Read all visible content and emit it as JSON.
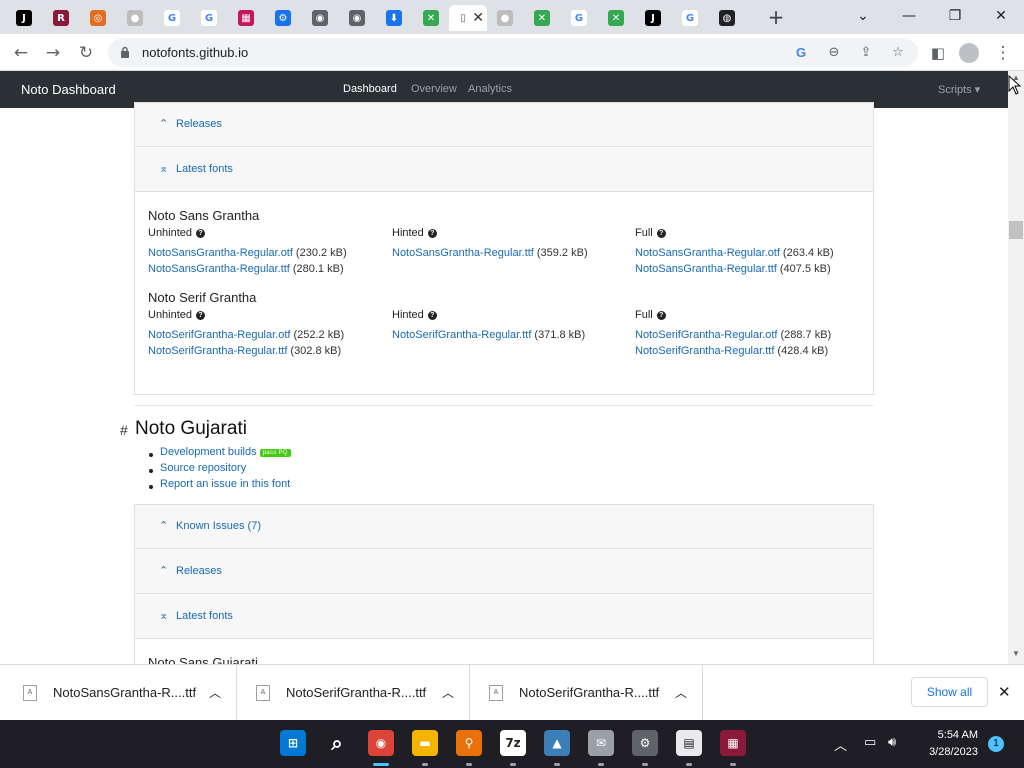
{
  "browser": {
    "tabs": [
      {
        "icon": "jetbrains-icon",
        "color": "#000000",
        "glyph": "J"
      },
      {
        "icon": "winrar-icon",
        "color": "#8b1a3a",
        "glyph": "R"
      },
      {
        "icon": "app-orange-icon",
        "color": "#e07020",
        "glyph": "◎"
      },
      {
        "icon": "github-icon",
        "color": "#bdbdbd",
        "glyph": "●"
      },
      {
        "icon": "google-icon",
        "color": "#ffffff",
        "glyph": "G"
      },
      {
        "icon": "google-bold-icon",
        "color": "#ffffff",
        "glyph": "G"
      },
      {
        "icon": "fontstruct-icon",
        "color": "#c2185b",
        "glyph": "▦"
      },
      {
        "icon": "settings-gear-icon",
        "color": "#1a73e8",
        "glyph": "⚙"
      },
      {
        "icon": "chrome-icon",
        "color": "#5f6368",
        "glyph": "◉"
      },
      {
        "icon": "chrome-icon-2",
        "color": "#5f6368",
        "glyph": "◉"
      },
      {
        "icon": "download-icon",
        "color": "#1a73e8",
        "glyph": "⬇"
      },
      {
        "icon": "noto-icon",
        "color": "#34a853",
        "glyph": "✕"
      },
      {
        "icon": "noto-dashboard-icon",
        "color": "#ffffff",
        "glyph": "▯",
        "active": true
      },
      {
        "icon": "github-icon-2",
        "color": "#bdbdbd",
        "glyph": "●"
      },
      {
        "icon": "noto-icon-2",
        "color": "#34a853",
        "glyph": "✕"
      },
      {
        "icon": "google-icon-2",
        "color": "#ffffff",
        "glyph": "G"
      },
      {
        "icon": "noto-icon-3",
        "color": "#34a853",
        "glyph": "✕"
      },
      {
        "icon": "jetbrains-icon-2",
        "color": "#000000",
        "glyph": "J"
      },
      {
        "icon": "google-icon-3",
        "color": "#ffffff",
        "glyph": "G"
      },
      {
        "icon": "globe-icon",
        "color": "#202124",
        "glyph": "◍"
      }
    ],
    "url": "notofonts.github.io"
  },
  "navbar": {
    "brand": "Noto Dashboard",
    "links": [
      "Dashboard",
      "Overview",
      "Analytics"
    ],
    "scripts": "Scripts ▾"
  },
  "grantha": {
    "releases_label": "Releases",
    "latest_label": "Latest fonts",
    "families": [
      {
        "name": "Noto Sans Grantha",
        "unhinted": [
          {
            "file": "NotoSansGrantha-Regular.otf",
            "size": "(230.2 kB)"
          },
          {
            "file": "NotoSansGrantha-Regular.ttf",
            "size": "(280.1 kB)"
          }
        ],
        "hinted": [
          {
            "file": "NotoSansGrantha-Regular.ttf",
            "size": "(359.2 kB)"
          }
        ],
        "full": [
          {
            "file": "NotoSansGrantha-Regular.otf",
            "size": "(263.4 kB)"
          },
          {
            "file": "NotoSansGrantha-Regular.ttf",
            "size": "(407.5 kB)"
          }
        ]
      },
      {
        "name": "Noto Serif Grantha",
        "unhinted": [
          {
            "file": "NotoSerifGrantha-Regular.otf",
            "size": "(252.2 kB)"
          },
          {
            "file": "NotoSerifGrantha-Regular.ttf",
            "size": "(302.8 kB)"
          }
        ],
        "hinted": [
          {
            "file": "NotoSerifGrantha-Regular.ttf",
            "size": "(371.8 kB)"
          }
        ],
        "full": [
          {
            "file": "NotoSerifGrantha-Regular.otf",
            "size": "(288.7 kB)"
          },
          {
            "file": "NotoSerifGrantha-Regular.ttf",
            "size": "(428.4 kB)"
          }
        ]
      }
    ],
    "col_labels": {
      "unhinted": "Unhinted",
      "hinted": "Hinted",
      "full": "Full"
    }
  },
  "gujarati": {
    "hash": "#",
    "title": "Noto Gujarati",
    "links": [
      "Development builds",
      "Source repository",
      "Report an issue in this font"
    ],
    "badge": "pass PQ",
    "known_issues": "Known Issues (7)",
    "releases_label": "Releases",
    "latest_label": "Latest fonts",
    "first_family": "Noto Sans Gujarati"
  },
  "downloads": {
    "items": [
      "NotoSansGrantha-R....ttf",
      "NotoSerifGrantha-R....ttf",
      "NotoSerifGrantha-R....ttf"
    ],
    "show_all": "Show all"
  },
  "taskbar": {
    "apps": [
      {
        "name": "start-icon",
        "color": "#0078d4",
        "glyph": "⊞"
      },
      {
        "name": "search-icon",
        "color": "transparent",
        "glyph": "⌕"
      },
      {
        "name": "chrome-taskbar-icon",
        "color": "#db4437",
        "glyph": "◉",
        "active": true
      },
      {
        "name": "file-explorer-icon",
        "color": "#f4b400",
        "glyph": "▬"
      },
      {
        "name": "magnifier-app-icon",
        "color": "#e8710a",
        "glyph": "⚲"
      },
      {
        "name": "7zip-icon",
        "color": "#ffffff",
        "glyph": "7z"
      },
      {
        "name": "inkscape-icon",
        "color": "#3c7fb8",
        "glyph": "▲"
      },
      {
        "name": "mail-app-icon",
        "color": "#9aa0a6",
        "glyph": "✉"
      },
      {
        "name": "settings-taskbar-icon",
        "color": "#5f6368",
        "glyph": "⚙"
      },
      {
        "name": "notepad-icon",
        "color": "#e8eaed",
        "glyph": "▤"
      },
      {
        "name": "winrar-taskbar-icon",
        "color": "#8b1a3a",
        "glyph": "▦"
      }
    ],
    "time": "5:54 AM",
    "date": "3/28/2023",
    "notifications": "1"
  }
}
